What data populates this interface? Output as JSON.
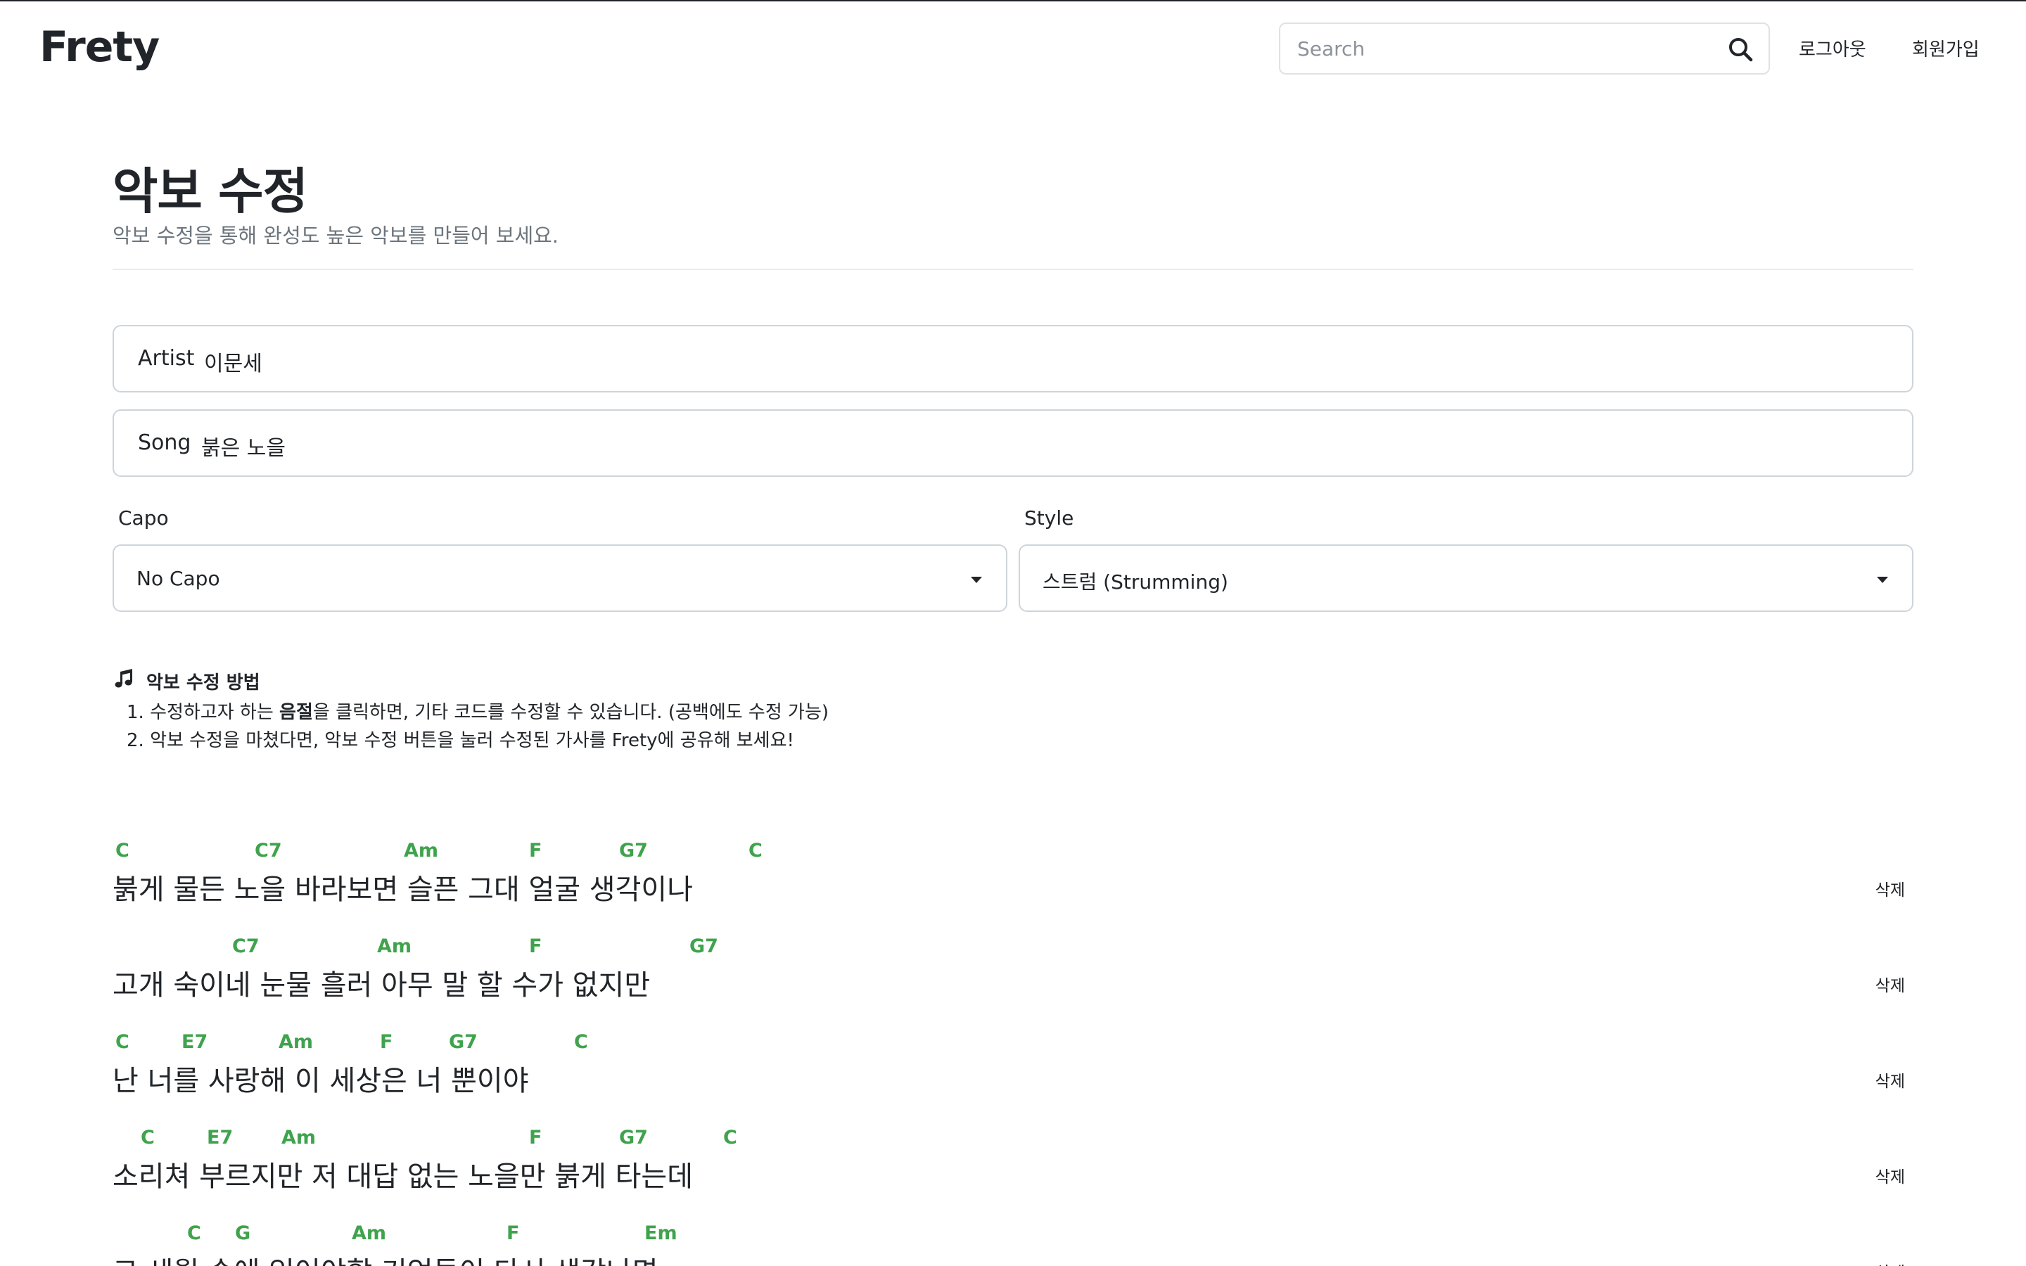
{
  "navbar": {
    "brand": "Frety",
    "search_placeholder": "Search",
    "logout_label": "로그아웃",
    "signup_label": "회원가입"
  },
  "header": {
    "title": "악보 수정",
    "subtitle": "악보 수정을 통해 완성도 높은 악보를 만들어 보세요."
  },
  "form": {
    "artist_label": "Artist",
    "artist_value": "이문세",
    "song_label": "Song",
    "song_value": "붉은 노을",
    "capo_label": "Capo",
    "capo_value": "No Capo",
    "style_label": "Style",
    "style_value": "스트럼 (Strumming)"
  },
  "instructions": {
    "title": "악보 수정 방법",
    "step1_prefix": "1. 수정하고자 하는 ",
    "step1_bold": "음절",
    "step1_suffix": "을 클릭하면, 기타 코드를 수정할 수 있습니다. (공백에도 수정 가능)",
    "step2": "2. 악보 수정을 마쳤다면, 악보 수정 버튼을 눌러 수정된 가사를 Frety에 공유해 보세요!"
  },
  "sheet": {
    "delete_label": "삭제",
    "lines": [
      {
        "lyric": "붉게  물든  노을  바라보면  슬픈  그대  얼굴  생각이나",
        "chords": [
          "C",
          "C7",
          "Am",
          "F",
          "G7",
          "C"
        ]
      },
      {
        "lyric": "고개  숙이네  눈물  흘러  아무  말  할  수가  없지만",
        "chords": [
          "C7",
          "Am",
          "F",
          "G7"
        ]
      },
      {
        "lyric": "난  너를  사랑해  이  세상은  너  뿐이야",
        "chords": [
          "C",
          "E7",
          "Am",
          "F",
          "G7",
          "C"
        ]
      },
      {
        "lyric": "소리쳐  부르지만  저  대답  없는  노을만  붉게  타는데",
        "chords": [
          "C",
          "E7",
          "Am",
          "F",
          "G7",
          "C"
        ]
      },
      {
        "lyric": "그  세월  속에  잊어야할  기억들이  다시  생각나면",
        "chords": [
          "C",
          "G",
          "Am",
          "F",
          "Em"
        ]
      }
    ]
  }
}
